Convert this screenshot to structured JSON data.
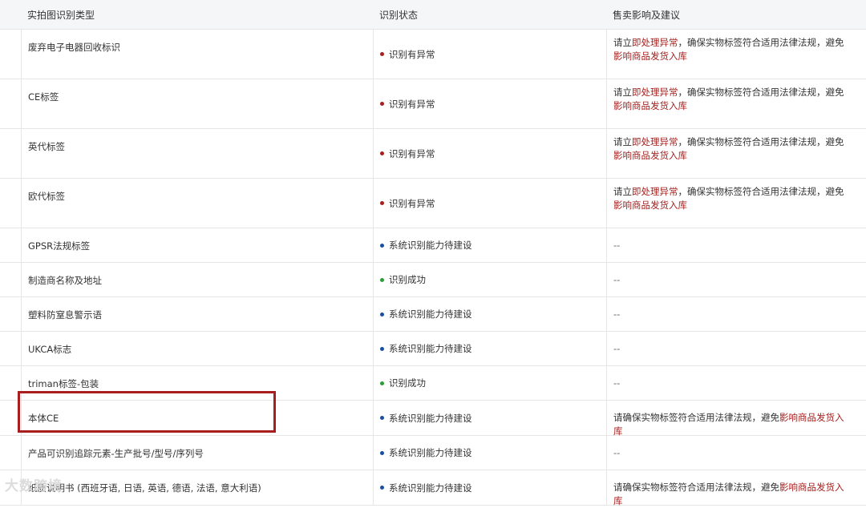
{
  "header": {
    "col1": "实拍图识别类型",
    "col2": "识别状态",
    "col3": "售卖影响及建议"
  },
  "colors": {
    "red": "#a5211f",
    "blue": "#1a4fa0",
    "green": "#2e9c3a"
  },
  "rows": [
    {
      "name": "废弃电子电器回收标识",
      "status": "识别有异常",
      "status_color": "red",
      "advice_parts": [
        "请立",
        "即处理异常",
        "，确保实物标签符合适用法律法规，避免",
        "影响商品发货入库"
      ]
    },
    {
      "name": "CE标签",
      "status": "识别有异常",
      "status_color": "red",
      "advice_parts": [
        "请立",
        "即处理异常",
        "，确保实物标签符合适用法律法规，避免",
        "影响商品发货入库"
      ]
    },
    {
      "name": "英代标签",
      "status": "识别有异常",
      "status_color": "red",
      "advice_parts": [
        "请立",
        "即处理异常",
        "，确保实物标签符合适用法律法规，避免",
        "影响商品发货入库"
      ]
    },
    {
      "name": "欧代标签",
      "status": "识别有异常",
      "status_color": "red",
      "advice_parts": [
        "请立",
        "即处理异常",
        "，确保实物标签符合适用法律法规，避免",
        "影响商品发货入库"
      ]
    },
    {
      "name": "GPSR法规标签",
      "status": "系统识别能力待建设",
      "status_color": "blue",
      "advice": "--"
    },
    {
      "name": "制造商名称及地址",
      "status": "识别成功",
      "status_color": "green",
      "advice": "--"
    },
    {
      "name": "塑料防窒息警示语",
      "status": "系统识别能力待建设",
      "status_color": "blue",
      "advice": "--"
    },
    {
      "name": "UKCA标志",
      "status": "系统识别能力待建设",
      "status_color": "blue",
      "advice": "--"
    },
    {
      "name": "triman标签-包装",
      "status": "识别成功",
      "status_color": "green",
      "advice": "--"
    },
    {
      "name": "本体CE",
      "status": "系统识别能力待建设",
      "status_color": "blue",
      "advice_single": [
        "请确保实物标签符合适用法律法规，避免",
        "影响商品发货入库"
      ]
    },
    {
      "name": "产品可识别追踪元素-生产批号/型号/序列号",
      "status": "系统识别能力待建设",
      "status_color": "blue",
      "advice": "--"
    },
    {
      "name": "纸质说明书 (西班牙语, 日语, 英语, 德语, 法语, 意大利语)",
      "status": "系统识别能力待建设",
      "status_color": "blue",
      "advice_single": [
        "请确保实物标签符合适用法律法规，避免",
        "影响商品发货入库"
      ]
    }
  ],
  "watermark": "大数跨境"
}
